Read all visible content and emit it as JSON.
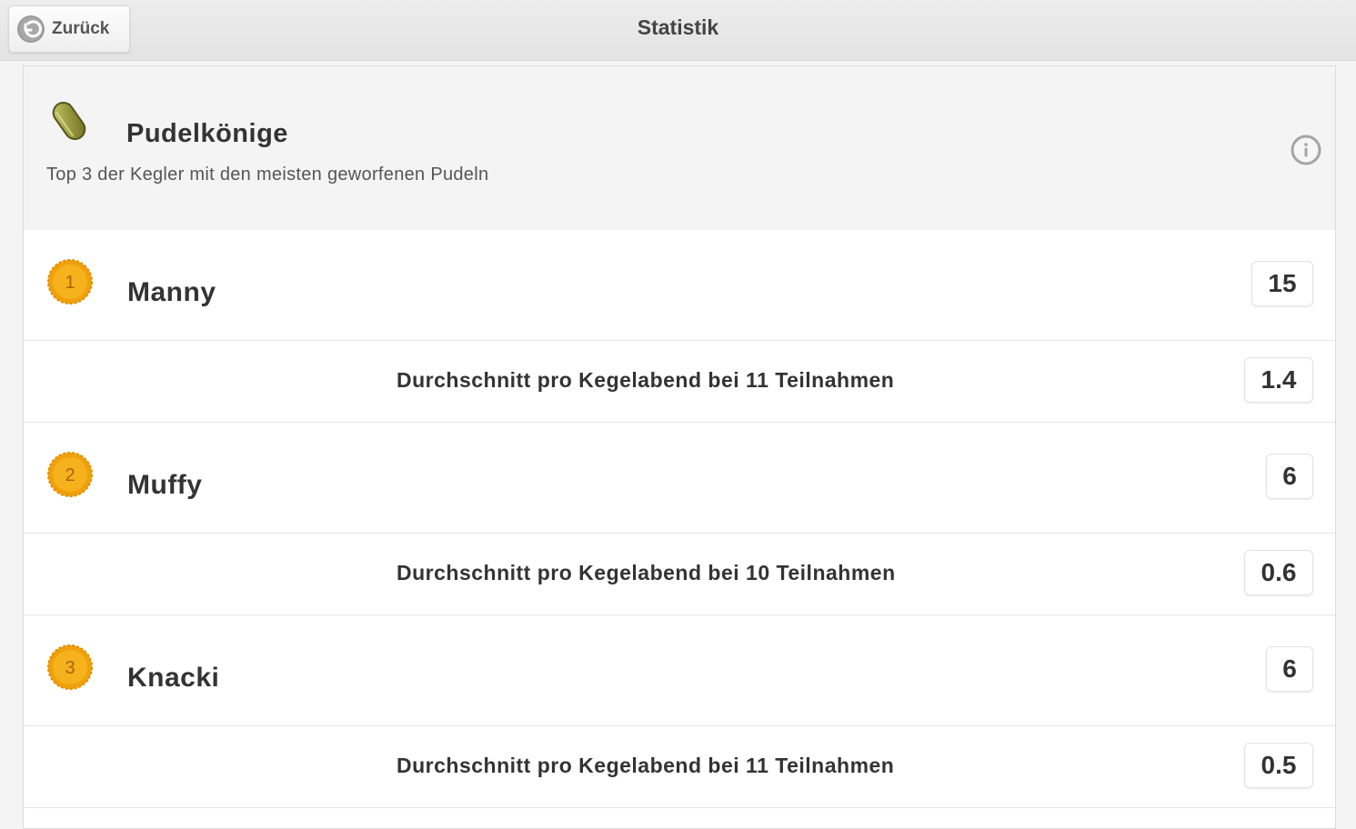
{
  "topbar": {
    "back_label": "Zurück",
    "title": "Statistik"
  },
  "card": {
    "title": "Pudelkönige",
    "subtitle": "Top 3 der Kegler mit den meisten geworfenen Pudeln",
    "icon": "trophy-icon",
    "info_icon": "info-icon"
  },
  "ranking": [
    {
      "rank": "1",
      "name": "Manny",
      "total": "15",
      "avg_prefix": "Durchschnitt pro Kegelabend bei",
      "participations": "11",
      "avg_suffix": "Teilnahmen",
      "average": "1.4"
    },
    {
      "rank": "2",
      "name": "Muffy",
      "total": "6",
      "avg_prefix": "Durchschnitt pro Kegelabend bei",
      "participations": "10",
      "avg_suffix": "Teilnahmen",
      "average": "0.6"
    },
    {
      "rank": "3",
      "name": "Knacki",
      "total": "6",
      "avg_prefix": "Durchschnitt pro Kegelabend bei",
      "participations": "11",
      "avg_suffix": "Teilnahmen",
      "average": "0.5"
    }
  ],
  "colors": {
    "medal": "#f2a60c",
    "trophy": "#8a8a2e",
    "topbar": "#e6e6e6"
  }
}
